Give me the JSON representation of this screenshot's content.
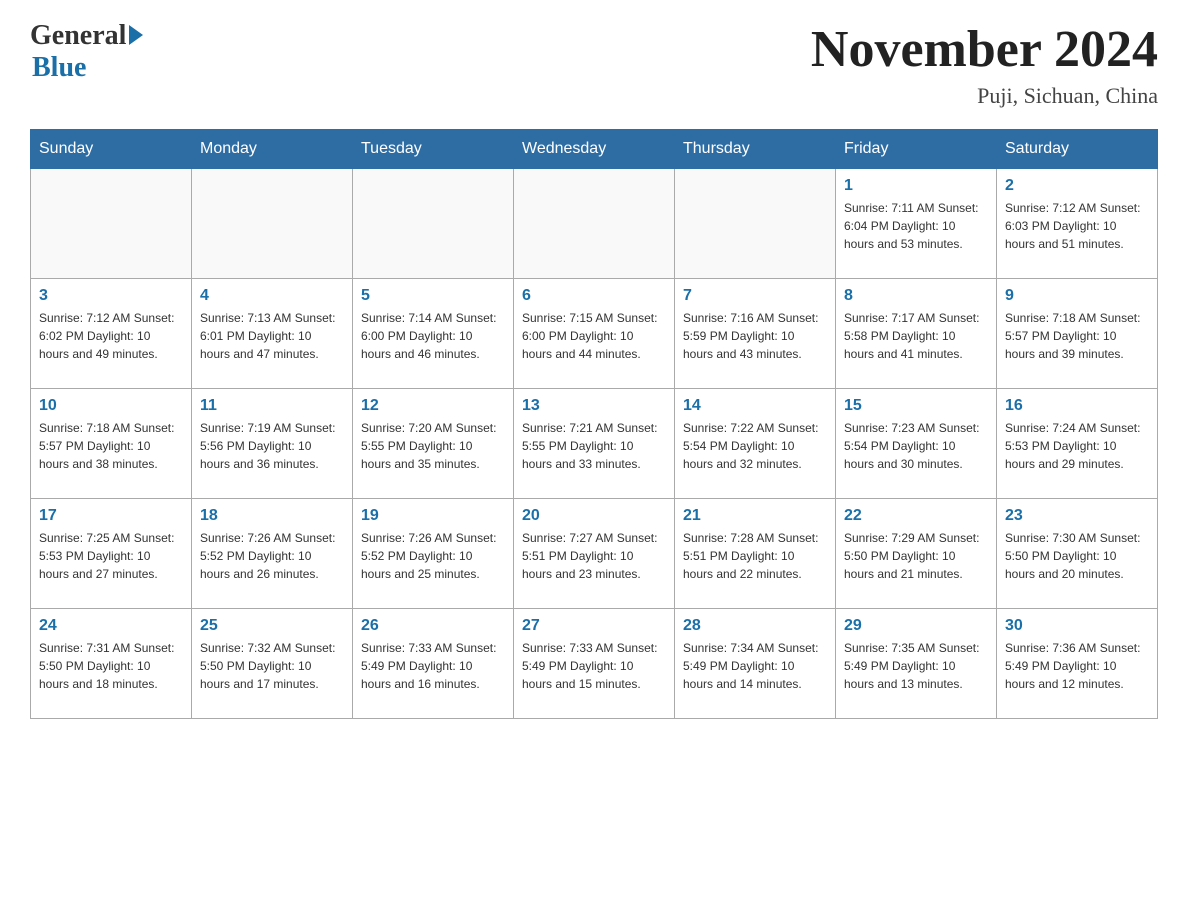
{
  "header": {
    "logo_general": "General",
    "logo_blue": "Blue",
    "month_title": "November 2024",
    "location": "Puji, Sichuan, China"
  },
  "days_of_week": [
    "Sunday",
    "Monday",
    "Tuesday",
    "Wednesday",
    "Thursday",
    "Friday",
    "Saturday"
  ],
  "weeks": [
    [
      {
        "day": "",
        "info": ""
      },
      {
        "day": "",
        "info": ""
      },
      {
        "day": "",
        "info": ""
      },
      {
        "day": "",
        "info": ""
      },
      {
        "day": "",
        "info": ""
      },
      {
        "day": "1",
        "info": "Sunrise: 7:11 AM\nSunset: 6:04 PM\nDaylight: 10 hours and 53 minutes."
      },
      {
        "day": "2",
        "info": "Sunrise: 7:12 AM\nSunset: 6:03 PM\nDaylight: 10 hours and 51 minutes."
      }
    ],
    [
      {
        "day": "3",
        "info": "Sunrise: 7:12 AM\nSunset: 6:02 PM\nDaylight: 10 hours and 49 minutes."
      },
      {
        "day": "4",
        "info": "Sunrise: 7:13 AM\nSunset: 6:01 PM\nDaylight: 10 hours and 47 minutes."
      },
      {
        "day": "5",
        "info": "Sunrise: 7:14 AM\nSunset: 6:00 PM\nDaylight: 10 hours and 46 minutes."
      },
      {
        "day": "6",
        "info": "Sunrise: 7:15 AM\nSunset: 6:00 PM\nDaylight: 10 hours and 44 minutes."
      },
      {
        "day": "7",
        "info": "Sunrise: 7:16 AM\nSunset: 5:59 PM\nDaylight: 10 hours and 43 minutes."
      },
      {
        "day": "8",
        "info": "Sunrise: 7:17 AM\nSunset: 5:58 PM\nDaylight: 10 hours and 41 minutes."
      },
      {
        "day": "9",
        "info": "Sunrise: 7:18 AM\nSunset: 5:57 PM\nDaylight: 10 hours and 39 minutes."
      }
    ],
    [
      {
        "day": "10",
        "info": "Sunrise: 7:18 AM\nSunset: 5:57 PM\nDaylight: 10 hours and 38 minutes."
      },
      {
        "day": "11",
        "info": "Sunrise: 7:19 AM\nSunset: 5:56 PM\nDaylight: 10 hours and 36 minutes."
      },
      {
        "day": "12",
        "info": "Sunrise: 7:20 AM\nSunset: 5:55 PM\nDaylight: 10 hours and 35 minutes."
      },
      {
        "day": "13",
        "info": "Sunrise: 7:21 AM\nSunset: 5:55 PM\nDaylight: 10 hours and 33 minutes."
      },
      {
        "day": "14",
        "info": "Sunrise: 7:22 AM\nSunset: 5:54 PM\nDaylight: 10 hours and 32 minutes."
      },
      {
        "day": "15",
        "info": "Sunrise: 7:23 AM\nSunset: 5:54 PM\nDaylight: 10 hours and 30 minutes."
      },
      {
        "day": "16",
        "info": "Sunrise: 7:24 AM\nSunset: 5:53 PM\nDaylight: 10 hours and 29 minutes."
      }
    ],
    [
      {
        "day": "17",
        "info": "Sunrise: 7:25 AM\nSunset: 5:53 PM\nDaylight: 10 hours and 27 minutes."
      },
      {
        "day": "18",
        "info": "Sunrise: 7:26 AM\nSunset: 5:52 PM\nDaylight: 10 hours and 26 minutes."
      },
      {
        "day": "19",
        "info": "Sunrise: 7:26 AM\nSunset: 5:52 PM\nDaylight: 10 hours and 25 minutes."
      },
      {
        "day": "20",
        "info": "Sunrise: 7:27 AM\nSunset: 5:51 PM\nDaylight: 10 hours and 23 minutes."
      },
      {
        "day": "21",
        "info": "Sunrise: 7:28 AM\nSunset: 5:51 PM\nDaylight: 10 hours and 22 minutes."
      },
      {
        "day": "22",
        "info": "Sunrise: 7:29 AM\nSunset: 5:50 PM\nDaylight: 10 hours and 21 minutes."
      },
      {
        "day": "23",
        "info": "Sunrise: 7:30 AM\nSunset: 5:50 PM\nDaylight: 10 hours and 20 minutes."
      }
    ],
    [
      {
        "day": "24",
        "info": "Sunrise: 7:31 AM\nSunset: 5:50 PM\nDaylight: 10 hours and 18 minutes."
      },
      {
        "day": "25",
        "info": "Sunrise: 7:32 AM\nSunset: 5:50 PM\nDaylight: 10 hours and 17 minutes."
      },
      {
        "day": "26",
        "info": "Sunrise: 7:33 AM\nSunset: 5:49 PM\nDaylight: 10 hours and 16 minutes."
      },
      {
        "day": "27",
        "info": "Sunrise: 7:33 AM\nSunset: 5:49 PM\nDaylight: 10 hours and 15 minutes."
      },
      {
        "day": "28",
        "info": "Sunrise: 7:34 AM\nSunset: 5:49 PM\nDaylight: 10 hours and 14 minutes."
      },
      {
        "day": "29",
        "info": "Sunrise: 7:35 AM\nSunset: 5:49 PM\nDaylight: 10 hours and 13 minutes."
      },
      {
        "day": "30",
        "info": "Sunrise: 7:36 AM\nSunset: 5:49 PM\nDaylight: 10 hours and 12 minutes."
      }
    ]
  ]
}
